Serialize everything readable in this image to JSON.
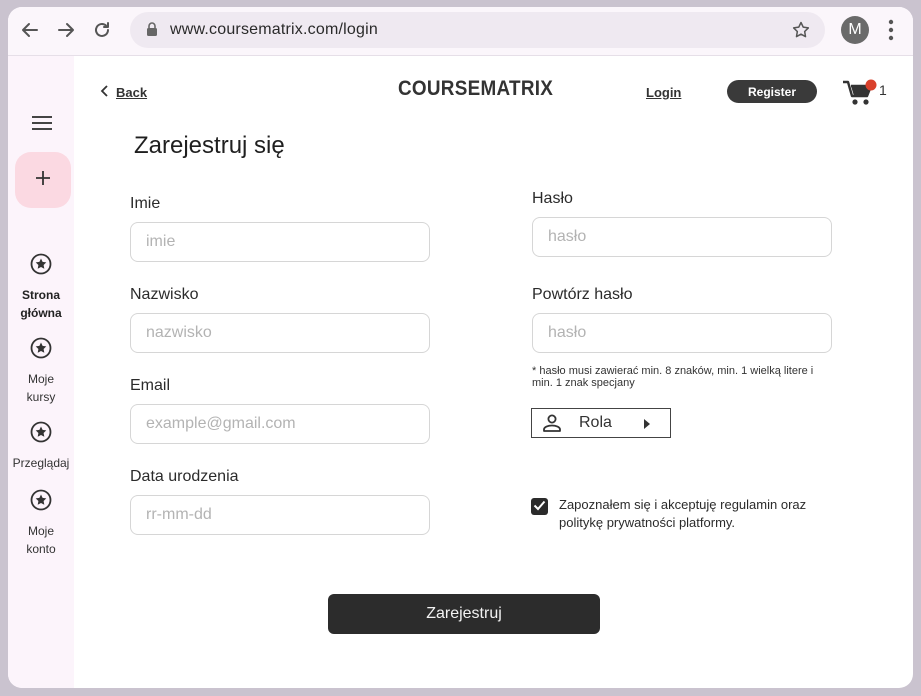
{
  "browser": {
    "url": "www.coursematrix.com/login",
    "avatar_letter": "M",
    "icons": [
      "back-arrow-icon",
      "forward-arrow-icon",
      "reload-icon",
      "lock-icon",
      "star-icon",
      "kebab-menu-icon"
    ]
  },
  "rail": {
    "items": [
      {
        "label": "Strona\ngłówna",
        "icon": "star-circle-icon",
        "active": true
      },
      {
        "label": "Moje\nkursy",
        "icon": "star-circle-icon",
        "active": false
      },
      {
        "label": "Przeglądaj",
        "icon": "star-circle-icon",
        "active": false
      },
      {
        "label": "Moje\nkonto",
        "icon": "star-circle-icon",
        "active": false
      }
    ]
  },
  "header": {
    "back_label": "Back",
    "brand": "COURSEMATRIX",
    "login_label": "Login",
    "register_label": "Register",
    "cart_count": "1"
  },
  "form": {
    "title": "Zarejestruj się",
    "first_name": {
      "label": "Imie",
      "placeholder": "imie"
    },
    "last_name": {
      "label": "Nazwisko",
      "placeholder": "nazwisko"
    },
    "email": {
      "label": "Email",
      "placeholder": "example@gmail.com"
    },
    "birth_date": {
      "label": "Data urodzenia",
      "placeholder": "rr-mm-dd"
    },
    "password": {
      "label": "Hasło",
      "placeholder": "hasło"
    },
    "password_repeat": {
      "label": "Powtórz hasło",
      "placeholder": "hasło"
    },
    "password_hint": "* hasło musi zawierać min. 8 znaków, min. 1 wielką litere i min. 1 znak specjany",
    "role_label": "Rola",
    "consent_text": "Zapoznałem się i akceptuję regulamin oraz politykę prywatności platformy.",
    "consent_checked": true,
    "submit_label": "Zarejestruj"
  },
  "colors": {
    "fab": "#fbd9e2",
    "rail_bg": "#fcf4fb",
    "dark_button": "#2c2c2c",
    "cart_badge": "#d9402b"
  }
}
